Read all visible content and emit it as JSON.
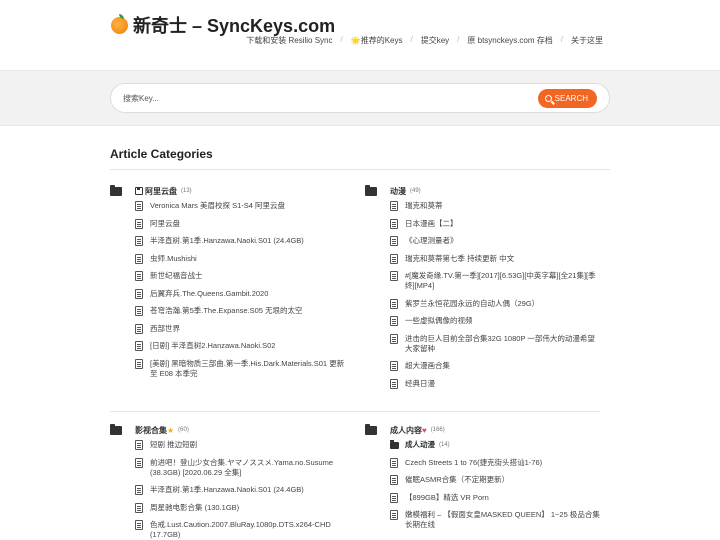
{
  "site": {
    "title": "新奇士 – SyncKeys.com",
    "nav": [
      "下载和安装 Resilio Sync",
      "🌟推荐的Keys",
      "提交key",
      "原 btsynckeys.com 存档",
      "关于这里"
    ]
  },
  "search": {
    "placeholder": "搜索Key...",
    "button_label": "SEARCH"
  },
  "section": {
    "heading": "Article Categories"
  },
  "categories": [
    {
      "title": "阿里云盘",
      "count": "(13)",
      "items": [
        "Veronica Mars 美眉校探 S1-S4 阿里云盘",
        "阿里云盘",
        "半泽直树.第1季.Hanzawa.Naoki.S01 (24.4GB)",
        "虫师.Mushishi",
        "新世纪福音战士",
        "后翼弃兵.The.Queens.Gambit.2020",
        "苍穹浩瀚.第5季.The.Expanse.S05 无垠的太空",
        "西部世界",
        "[日剧] 半泽直树2.Hanzawa.Naoki.S02",
        "[美剧] 黑暗物质三部曲.第一季.His.Dark.Materials.S01 更新至 E08 本季完"
      ]
    },
    {
      "title": "动漫",
      "count": "(49)",
      "items": [
        "瑞克和莫蒂",
        "日本漫画【二】",
        "《心理测量者》",
        "瑞克和莫蒂第七季 持续更新 中文",
        "#[魔发奇缘.TV.第一季][2017][6.53G][中英字幕][全21集][季终][MP4]",
        "紫罗兰永恒花园永远的自动人偶（29G）",
        "一些虚拟偶像的视频",
        "进击的巨人目前全部合集32G 1080P 一部伟大的动漫希望大家留种",
        "超大漫画合集",
        "经典日漫"
      ]
    },
    {
      "title": "影视合集",
      "count": "(60)",
      "items": [
        "短剧 推边短剧",
        "前进吧！登山少女合集.ヤマノススメ.Yama.no.Susume (38.3GB) [2020.06.29 全集]",
        "半泽直树.第1季.Hanzawa.Naoki.S01 (24.4GB)",
        "周星驰电影合集 (130.1GB)",
        "色戒.Lust.Caution.2007.BluRay.1080p.DTS.x264-CHD (17.7GB)"
      ]
    },
    {
      "title": "成人内容",
      "count": "(166)",
      "sub_title": "成人动漫",
      "sub_count": "(14)",
      "items": [
        "Czech Streets 1 to 76(捷克街头搭讪1-76)",
        "催眠ASMR合集（不定期更新）",
        "【899GB】精选 VR Porn",
        "嫩模福利 – 【假面女皇MASKED QUEEN】 1~25 极品合集 长期在线"
      ]
    }
  ]
}
